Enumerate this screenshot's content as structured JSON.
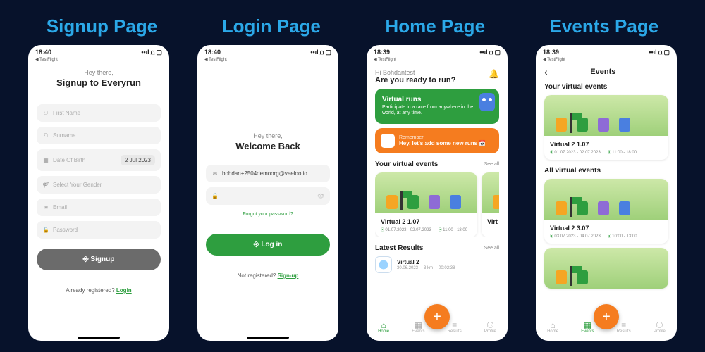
{
  "headers": {
    "signup": "Signup Page",
    "login": "Login Page",
    "home": "Home Page",
    "events": "Events Page"
  },
  "status": {
    "time1": "18:40",
    "time2": "18:39",
    "testflight": "◀ TestFlight",
    "signal": "••ıl",
    "wifi": "⩍",
    "battery": "▢"
  },
  "signup": {
    "hey": "Hey there,",
    "title": "Signup to Everyrun",
    "firstName": "First Name",
    "surname": "Surname",
    "dob": "Date Of Birth",
    "dobVal": "2 Jul 2023",
    "gender": "Select Your Gender",
    "email": "Email",
    "password": "Password",
    "btn": "⎆ Signup",
    "already": "Already registered? ",
    "loginLink": "Login"
  },
  "login": {
    "hey": "Hey there,",
    "title": "Welcome Back",
    "emailVal": "bohdan+2504demoorg@veeloo.io",
    "btn": "⎆ Log in",
    "forgot": "Forgot your password?",
    "notReg": "Not registered? ",
    "signupLink": "Sign-up"
  },
  "home": {
    "greetSmall": "Hi Bohdantest",
    "greetBig": "Are you ready to run?",
    "vr_title": "Virtual runs",
    "vr_sub": "Participate in a race from anywhere in the world, at any time.",
    "rem_t": "Remember!",
    "rem_s": "Hey, let's add some new runs 📅",
    "yourEvents": "Your virtual events",
    "seeAll": "See all",
    "eventName": "Virtual 2  1.07",
    "eventNameB": "Virt",
    "eDate": "01.07.2023 - 02.07.2023",
    "eTime": "11:00 - 18:00",
    "latest": "Latest Results",
    "resName": "Virtual 2",
    "resDate": "30.06.2023",
    "resDist": "3 km",
    "resDur": "00:02:38"
  },
  "events": {
    "title": "Events",
    "your": "Your virtual events",
    "evA": "Virtual 2  1.07",
    "evA_date": "01.07.2023 - 02.07.2023",
    "evA_time": "11:00 - 18:00",
    "all": "All virtual events",
    "evB": "Virtual 2 3.07",
    "evB_date": "03.07.2023 - 04.07.2023",
    "evB_time": "10:00 - 13:00"
  },
  "tabs": {
    "home": "Home",
    "events": "Events",
    "results": "Results",
    "profile": "Profile"
  }
}
